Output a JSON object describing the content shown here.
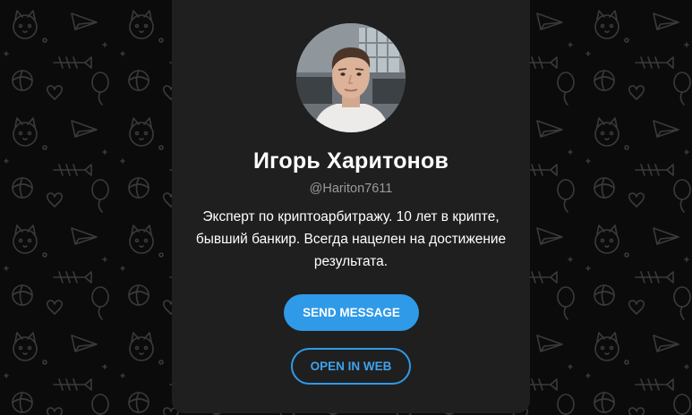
{
  "profile": {
    "name": "Игорь Харитонов",
    "username": "@Hariton7611",
    "bio": "Эксперт по криптоарбитражу. 10 лет в крипте, бывший банкир. Всегда нацелен на достижение результата."
  },
  "buttons": {
    "send_message": "SEND MESSAGE",
    "open_in_web": "OPEN IN WEB"
  },
  "colors": {
    "accent": "#2f9ae8",
    "card_background": "#1f1f1f",
    "page_background": "#0b0b0b",
    "name_text": "#ffffff",
    "username_text": "#9a9a9a"
  }
}
